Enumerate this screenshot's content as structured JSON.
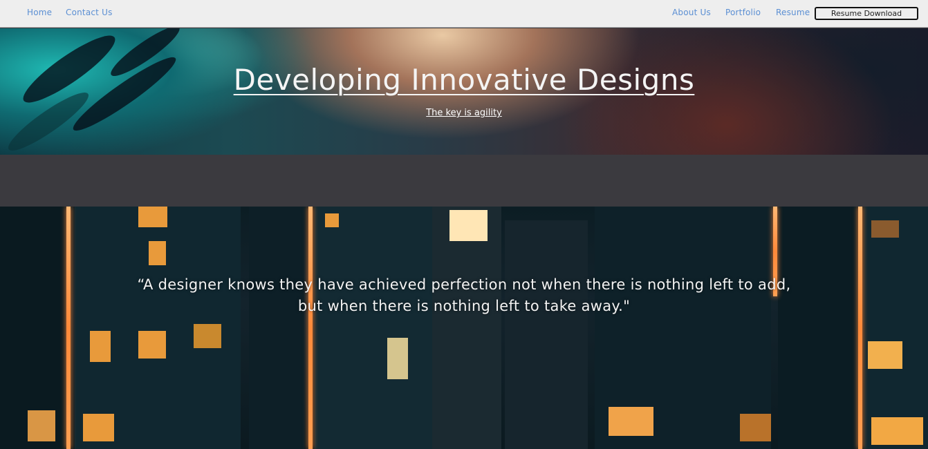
{
  "nav": {
    "left": [
      "Home",
      "Contact Us"
    ],
    "right": [
      "About Us",
      "Portfolio",
      "Resume"
    ],
    "resume_download": "Resume Download"
  },
  "hero": {
    "title": "Developing Innovative Designs",
    "subtitle": "The key is agility"
  },
  "quote": {
    "line1": "“A designer knows they have achieved perfection not when there is nothing left to add,",
    "line2": "but when there is nothing left to take away.\""
  },
  "colors": {
    "nav_bg": "#eeeeee",
    "nav_link": "#5b8fd3",
    "band": "#3b3a3f",
    "accent_orange": "#ff8a3a"
  }
}
